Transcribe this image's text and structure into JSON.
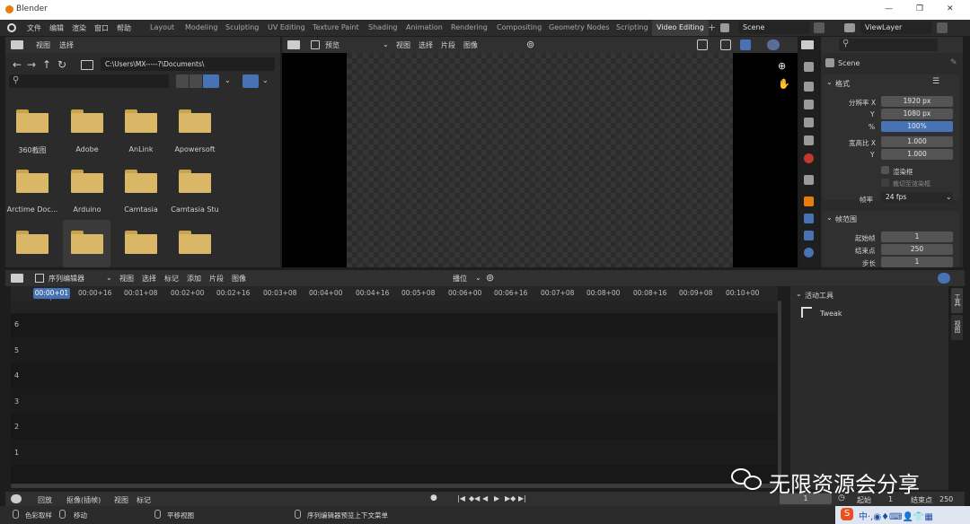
{
  "title_bar": {
    "app_title": "Blender",
    "window_controls": [
      "—",
      "❐",
      "✕"
    ]
  },
  "menu": [
    "文件",
    "编辑",
    "渲染",
    "窗口",
    "帮助"
  ],
  "workspaces": [
    "Layout",
    "Modeling",
    "Sculpting",
    "UV Editing",
    "Texture Paint",
    "Shading",
    "Animation",
    "Rendering",
    "Compositing",
    "Geometry Nodes",
    "Scripting",
    "Video Editing"
  ],
  "workspace_active": "Video Editing",
  "workspace_add": "+",
  "scene_name": "Scene",
  "view_layer": "ViewLayer",
  "file_browser": {
    "menu": [
      "视图",
      "选择"
    ],
    "path": "C:\\Users\\MX-----?\\Documents\\",
    "search_placeholder": "",
    "folders": [
      "360截图",
      "Adobe",
      "AnLink",
      "Apowersoft",
      "Arctime Doc...",
      "Arduino",
      "Camtasia",
      "Camtasia Stu",
      "",
      "",
      "",
      ""
    ]
  },
  "preview": {
    "mode": "预览",
    "menu": [
      "视图",
      "选择",
      "片段",
      "图像"
    ]
  },
  "properties": {
    "scene_label": "Scene",
    "format_section": "格式",
    "res_x_label": "分辨率 X",
    "res_x": "1920 px",
    "res_y_label": "Y",
    "res_y": "1080 px",
    "pct_label": "%",
    "pct": "100%",
    "aspect_x_label": "宽高比 X",
    "aspect_x": "1.000",
    "aspect_y_label": "Y",
    "aspect_y": "1.000",
    "render_region": "渲染框",
    "crop": "裁切至渲染框",
    "fps_label": "帧率",
    "fps": "24 fps",
    "frame_range_section": "帧范围",
    "start_label": "起始帧",
    "start": "1",
    "end_label": "结束点",
    "end": "250",
    "step_label": "步长",
    "step": "1"
  },
  "sequencer": {
    "editor": "序列编辑器",
    "menu": [
      "视图",
      "选择",
      "标记",
      "添加",
      "片段",
      "图像"
    ],
    "snap": "播位",
    "current_time": "00:00+01",
    "ticks": [
      "00:00+16",
      "00:01+08",
      "00:02+00",
      "00:02+16",
      "00:03+08",
      "00:04+00",
      "00:04+16",
      "00:05+08",
      "00:06+00",
      "00:06+16",
      "00:07+08",
      "00:08+00",
      "00:08+16",
      "00:09+08",
      "00:10+00"
    ],
    "channels": [
      "6",
      "5",
      "4",
      "3",
      "2",
      "1"
    ],
    "tools_panel": "活动工具",
    "tool_name": "Tweak",
    "side_tabs": [
      "工具",
      "视图"
    ]
  },
  "timeline": {
    "playback": "回放",
    "keying": "抠像(插帧)",
    "view": "视图",
    "marker": "标记",
    "current_frame": "1",
    "start_label": "起始",
    "start": "1",
    "end_label": "结束点",
    "end": "250"
  },
  "status_bar": [
    "色彩取样",
    "移动",
    "平移视图",
    "序列编辑器预览上下文菜单"
  ],
  "watermark": "无限资源会分享",
  "colors": {
    "accent": "#4772b3",
    "folder": "#d9b766",
    "bg": "#1d1d1d",
    "panel": "#2b2b2b",
    "header": "#303030"
  }
}
